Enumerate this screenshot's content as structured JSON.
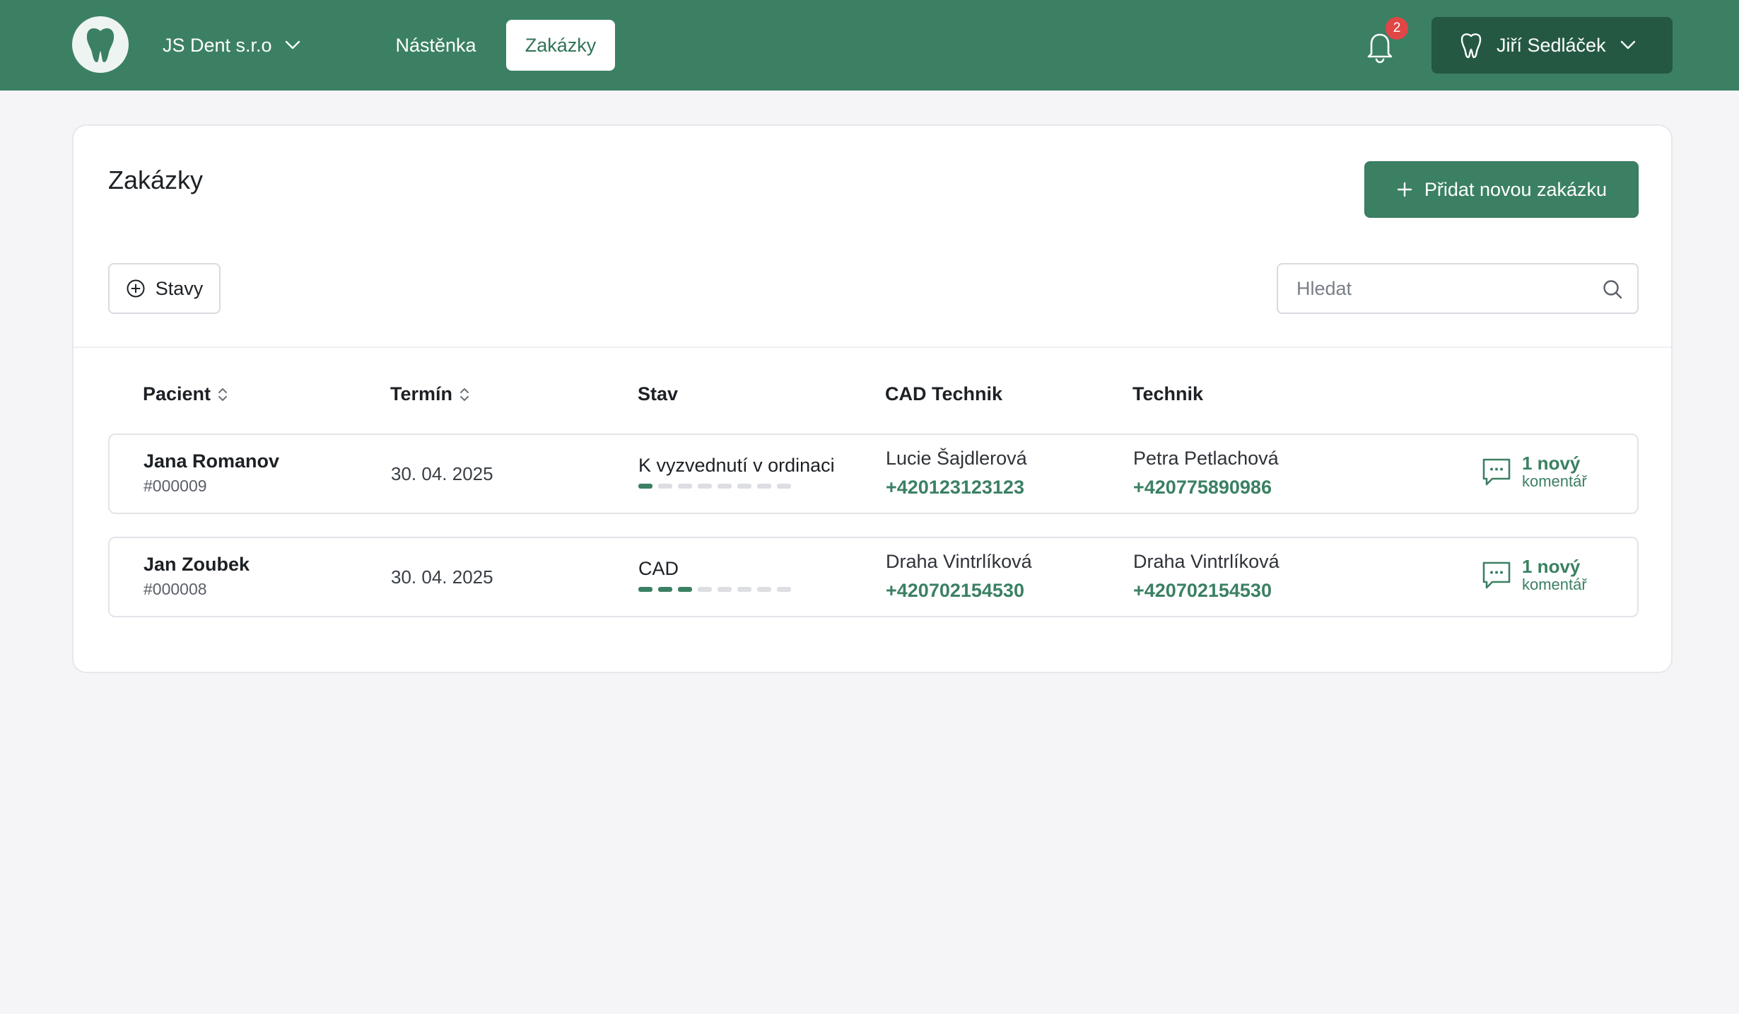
{
  "header": {
    "company": "JS Dent s.r.o",
    "nav": [
      {
        "label": "Nástěnka",
        "active": false
      },
      {
        "label": "Zakázky",
        "active": true
      }
    ],
    "notifications_count": "2",
    "user_name": "Jiří Sedláček"
  },
  "page": {
    "title": "Zakázky",
    "add_button": "Přidat novou zakázku",
    "filter_button": "Stavy",
    "search_placeholder": "Hledat"
  },
  "table": {
    "columns": [
      "Pacient",
      "Termín",
      "Stav",
      "CAD Technik",
      "Technik"
    ],
    "rows": [
      {
        "patient": "Jana Romanov",
        "id": "#000009",
        "date": "30. 04. 2025",
        "status": "K vyzvednutí v ordinaci",
        "progress_steps_done": 1,
        "progress_steps_total": 8,
        "cad_name": "Lucie Šajdlerová",
        "cad_phone": "+420123123123",
        "tech_name": "Petra Petlachová",
        "tech_phone": "+420775890986",
        "comment_top": "1 nový",
        "comment_bottom": "komentář"
      },
      {
        "patient": "Jan Zoubek",
        "id": "#000008",
        "date": "30. 04. 2025",
        "status": "CAD",
        "progress_steps_done": 3,
        "progress_steps_total": 8,
        "cad_name": "Draha Vintrlíková",
        "cad_phone": "+420702154530",
        "tech_name": "Draha Vintrlíková",
        "tech_phone": "+420702154530",
        "comment_top": "1 nový",
        "comment_bottom": "komentář"
      }
    ]
  },
  "colors": {
    "brand": "#3b8063",
    "brand_dark": "#245843",
    "badge": "#e04646"
  }
}
